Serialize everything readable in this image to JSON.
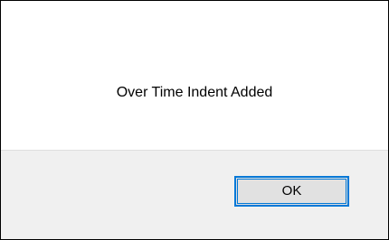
{
  "dialog": {
    "message": "Over Time Indent Added",
    "ok_label": "OK",
    "close_glyph": "✕"
  },
  "colors": {
    "accent": "#0078d7",
    "footer_background": "#f0f0f0",
    "button_background": "#e1e1e1"
  }
}
